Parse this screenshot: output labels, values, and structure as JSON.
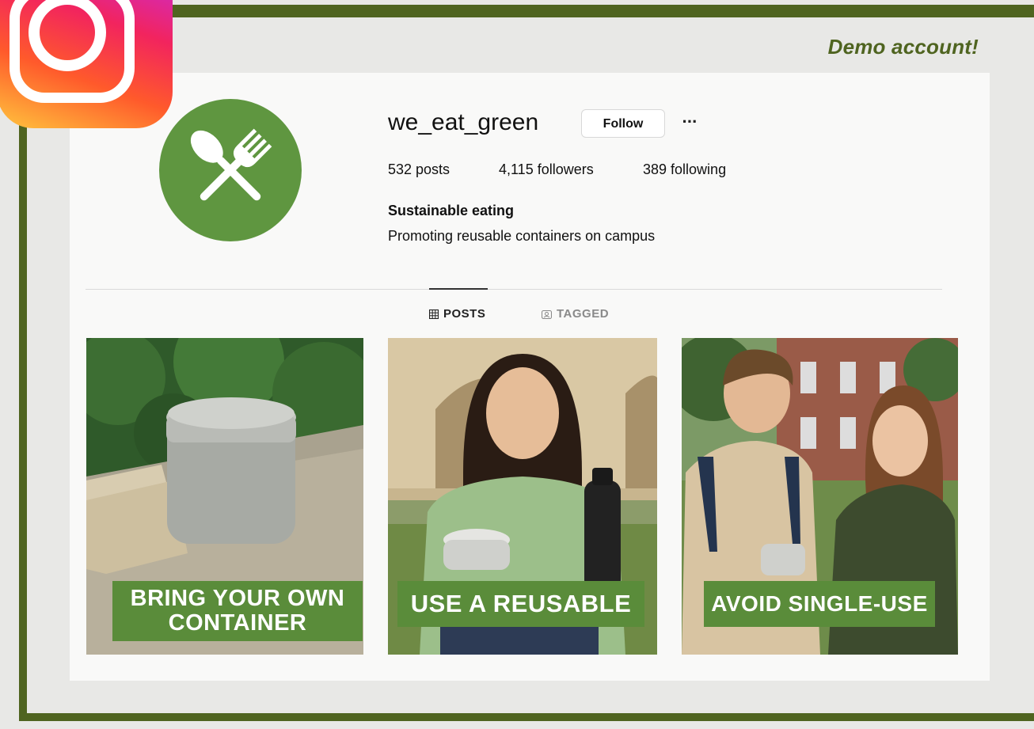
{
  "demo_label": "Demo account!",
  "profile": {
    "username": "we_eat_green",
    "follow_label": "Follow",
    "more_label": "···",
    "stats": {
      "posts": "532 posts",
      "followers": "4,115 followers",
      "following": "389 following"
    },
    "bio_name": "Sustainable eating",
    "bio_text": "Promoting reusable containers on campus"
  },
  "tabs": [
    {
      "label": "POSTS",
      "icon": "grid-icon",
      "active": true
    },
    {
      "label": "TAGGED",
      "icon": "tag-icon",
      "active": false
    }
  ],
  "posts": [
    {
      "caption_line1": "BRING YOUR OWN",
      "caption_line2": "CONTAINER",
      "image": "reusable container on stone ledge"
    },
    {
      "caption": "USE A REUSABLE",
      "image": "student holding bowl and water bottle"
    },
    {
      "caption": "AVOID SINGLE-USE",
      "image": "two students on campus lawn"
    }
  ],
  "colors": {
    "frame": "#4f6420",
    "caption_bg": "#5a8c3a",
    "avatar_bg": "#5f9640"
  }
}
